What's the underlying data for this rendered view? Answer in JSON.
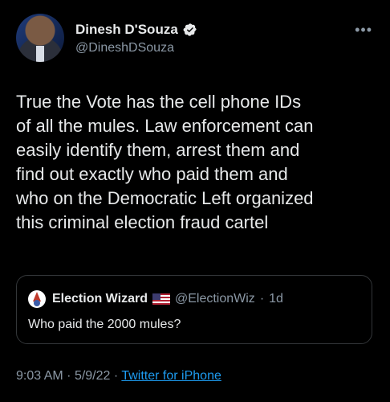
{
  "author": {
    "name": "Dinesh D'Souza",
    "handle": "@DineshDSouza",
    "avatar_icon": "profile-photo",
    "verified_icon": "verified-badge-icon"
  },
  "more_icon_text": "•••",
  "tweet": {
    "text": "True the Vote has the cell phone IDs\nof all the mules. Law enforcement can\neasily identify them, arrest them and\nfind out exactly who paid them and\nwho on the Democratic Left organized\nthis criminal election fraud cartel"
  },
  "quoted": {
    "name": "Election Wizard",
    "handle": "@ElectionWiz",
    "separator": "·",
    "age": "1d",
    "text": "Who paid the 2000 mules?",
    "flag_icon": "us-flag-icon"
  },
  "meta": {
    "time": "9:03 AM",
    "date": "5/9/22",
    "separator": "·",
    "client": "Twitter for iPhone"
  },
  "colors": {
    "background": "#000000",
    "text": "#e7e9ea",
    "muted": "#8b98a5",
    "link": "#1d9bf0",
    "verified": "#e7e9ea"
  }
}
